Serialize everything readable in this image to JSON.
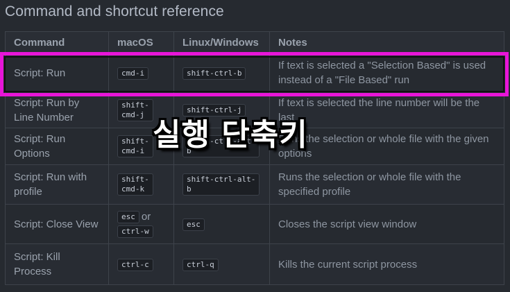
{
  "title": "Command and shortcut reference",
  "columns": [
    "Command",
    "macOS",
    "Linux/Windows",
    "Notes"
  ],
  "rows": [
    {
      "command": "Script: Run",
      "mac": "cmd-i",
      "linux": "shift-ctrl-b",
      "note": "If text is selected a \"Selection Based\" is used instead of a \"File Based\" run"
    },
    {
      "command": "Script: Run by Line Number",
      "mac": "shift-\ncmd-j",
      "linux": "shift-ctrl-j",
      "note": "If text is selected the line number will be the last"
    },
    {
      "command": "Script: Run Options",
      "mac": "shift-\ncmd-i",
      "linux": "shift-ctrl-alt-\nb",
      "note": "Runs the selection or whole file with the given options"
    },
    {
      "command": "Script: Run with profile",
      "mac": "shift-\ncmd-k",
      "linux": "shift-ctrl-alt-\nb",
      "note": "Runs the selection or whole file with the specified profile"
    },
    {
      "command": "Script: Close View",
      "mac": "esc",
      "mac_or": "or",
      "mac2": "ctrl-w",
      "linux": "esc",
      "note": "Closes the script view window"
    },
    {
      "command": "Script: Kill Process",
      "mac": "ctrl-c",
      "linux": "ctrl-q",
      "note": "Kills the current script process"
    }
  ],
  "overlay_text": "실행 단축키",
  "highlight_color": "#e815d8"
}
